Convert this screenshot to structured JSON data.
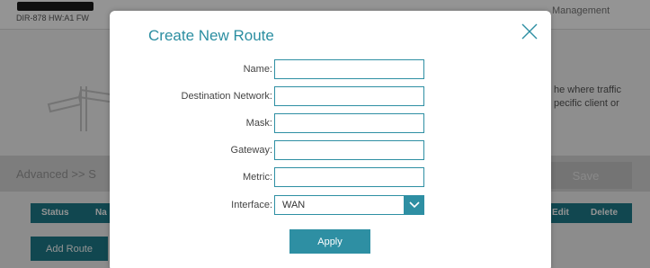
{
  "header": {
    "model": "DIR-878 HW:A1 FW",
    "nav_right": "Management"
  },
  "intro": {
    "description": "he where traffic pecific client or"
  },
  "toolbar": {
    "breadcrumb": "Advanced >> S",
    "save_label": "Save"
  },
  "table": {
    "headers": [
      "Status",
      "Na",
      "Edit",
      "Delete"
    ]
  },
  "add_route_label": "Add Route",
  "modal": {
    "title": "Create New Route",
    "fields": {
      "name": {
        "label": "Name:",
        "value": ""
      },
      "destination": {
        "label": "Destination Network:",
        "value": ""
      },
      "mask": {
        "label": "Mask:",
        "value": ""
      },
      "gateway": {
        "label": "Gateway:",
        "value": ""
      },
      "metric": {
        "label": "Metric:",
        "value": ""
      },
      "interface": {
        "label": "Interface:",
        "value": "WAN"
      }
    },
    "apply_label": "Apply"
  },
  "icons": {
    "close": "close-icon",
    "dropdown": "chevron-down-icon",
    "sign": "signpost-icon",
    "logo": "dlink-logo"
  },
  "colors": {
    "accent": "#2e8fa3",
    "table_header": "#1e7b8a",
    "save_disabled": "#c8c8c8"
  }
}
